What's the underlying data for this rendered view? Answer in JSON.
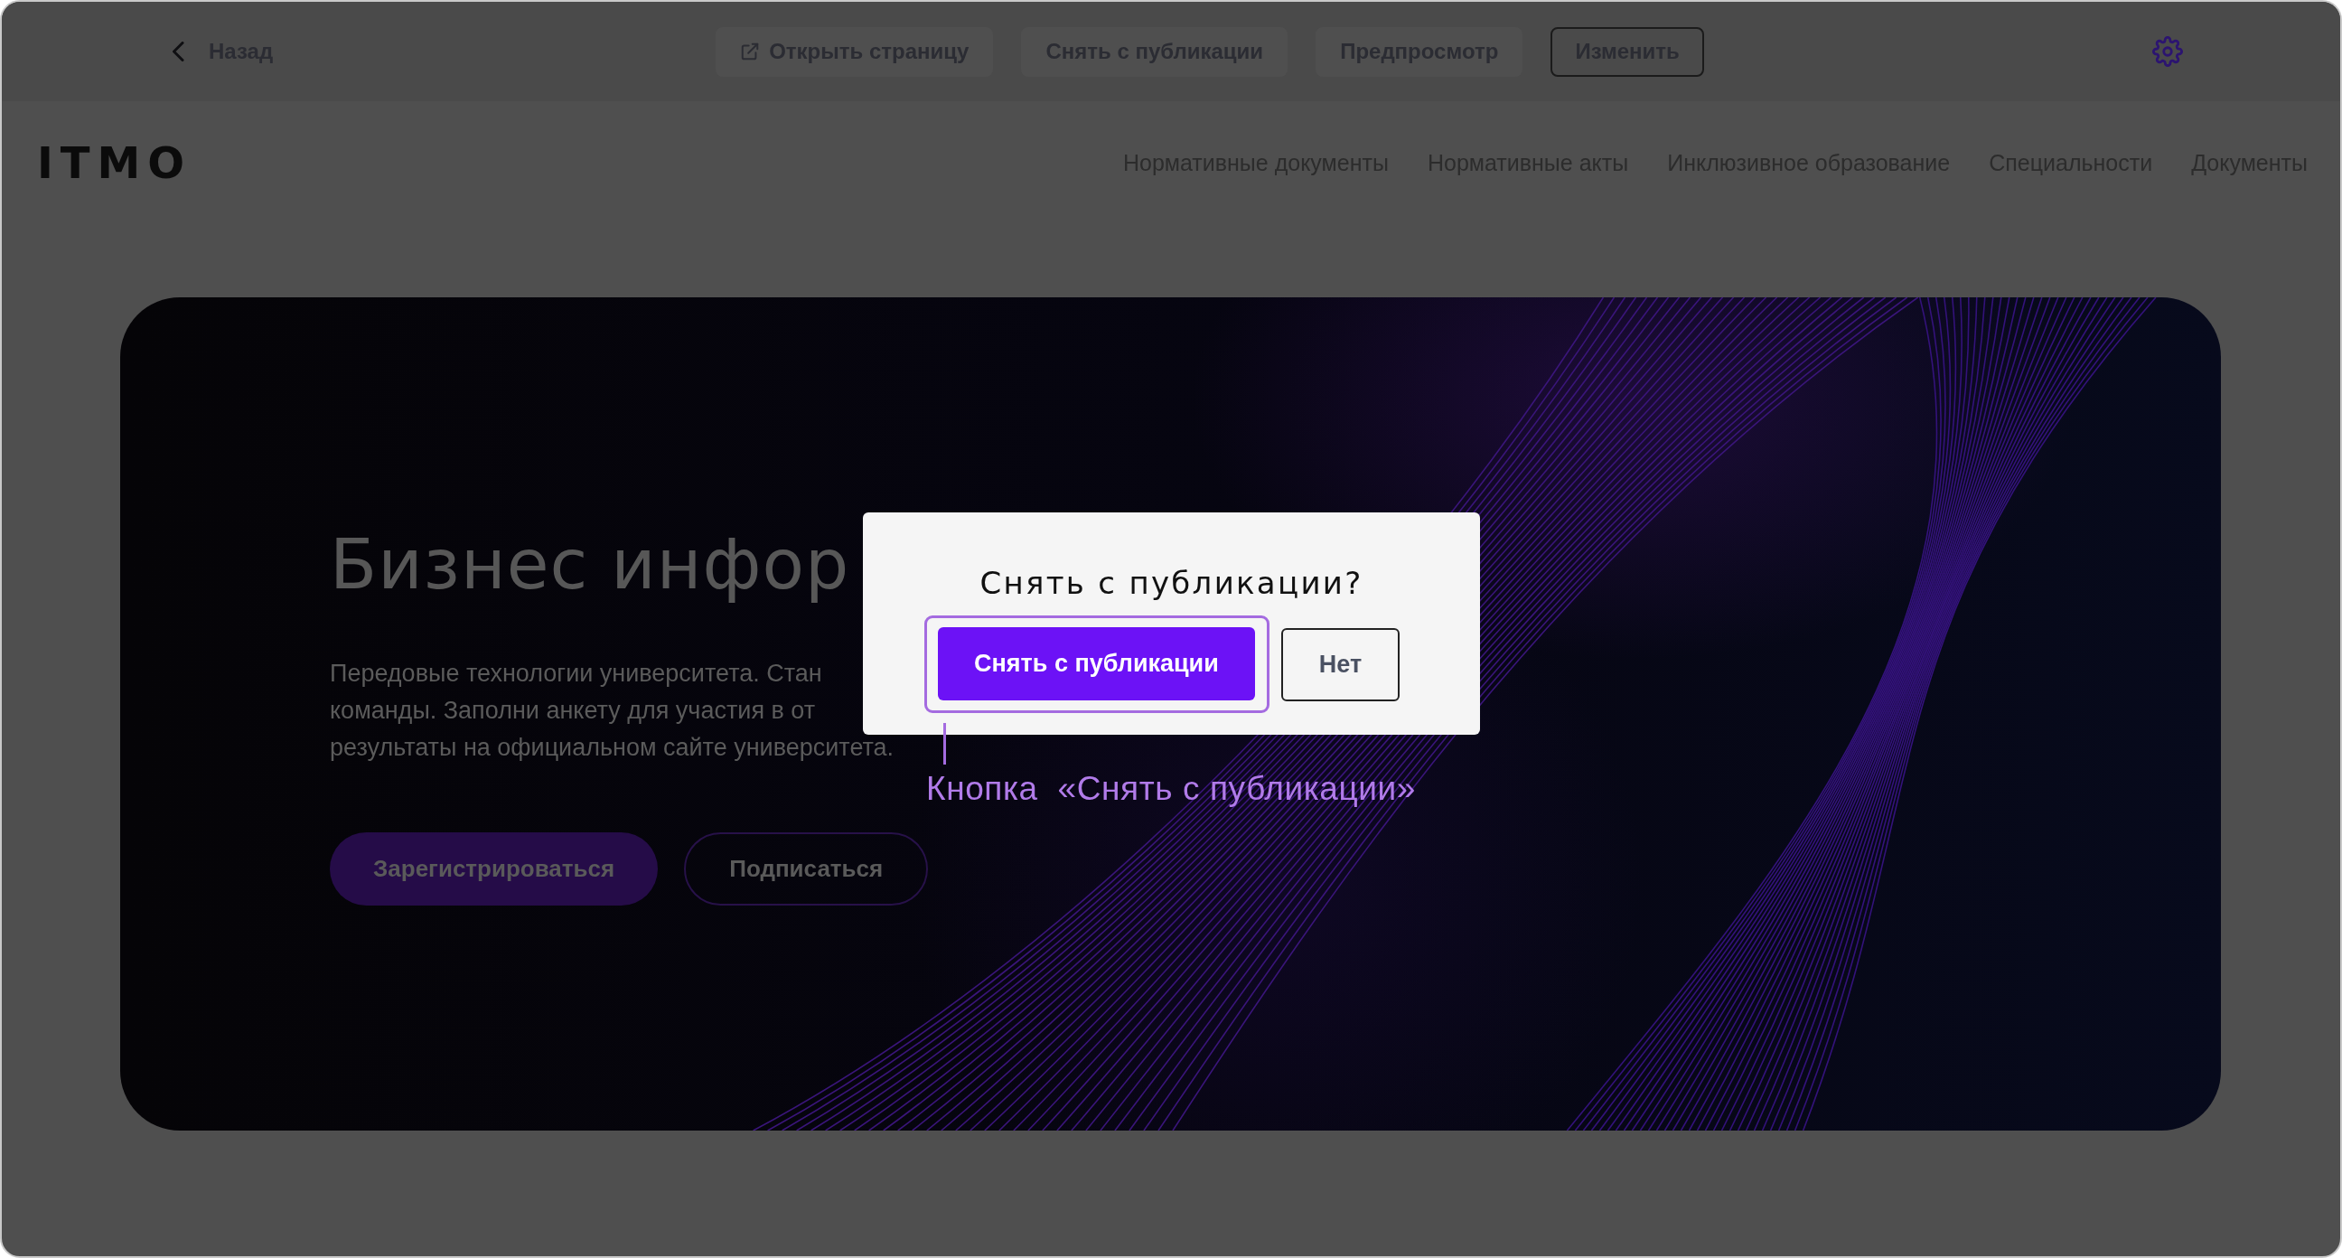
{
  "toolbar": {
    "back": {
      "label": "Назад"
    },
    "actions": [
      {
        "label": "Открыть страницу",
        "kind": "link"
      },
      {
        "label": "Снять с публикации",
        "kind": "filled"
      },
      {
        "label": "Предпросмотр",
        "kind": "filled"
      },
      {
        "label": "Изменить",
        "kind": "outlined"
      }
    ]
  },
  "site_header": {
    "logo": "ITMO",
    "nav": [
      "Нормативные документы",
      "Нормативные акты",
      "Инклюзивное образование",
      "Специальности",
      "Документы"
    ]
  },
  "hero": {
    "title": "Бизнес инфор",
    "description_lines": [
      "Передовые технологии университета. Стан",
      "команды. Заполни анкету для участия в от",
      "результаты на официальном сайте университета."
    ],
    "buttons": [
      {
        "label": "Зарегистрироваться",
        "kind": "primary"
      },
      {
        "label": "Подписаться",
        "kind": "outlined"
      }
    ]
  },
  "dialog": {
    "title": "Снять с публикации?",
    "buttons": [
      {
        "label": "Снять с публикации",
        "kind": "primary",
        "highlighted": true
      },
      {
        "label": "Нет",
        "kind": "outlined",
        "highlighted": false
      }
    ]
  },
  "annotation": {
    "label": "Кнопка  «Снять с публикации»"
  }
}
